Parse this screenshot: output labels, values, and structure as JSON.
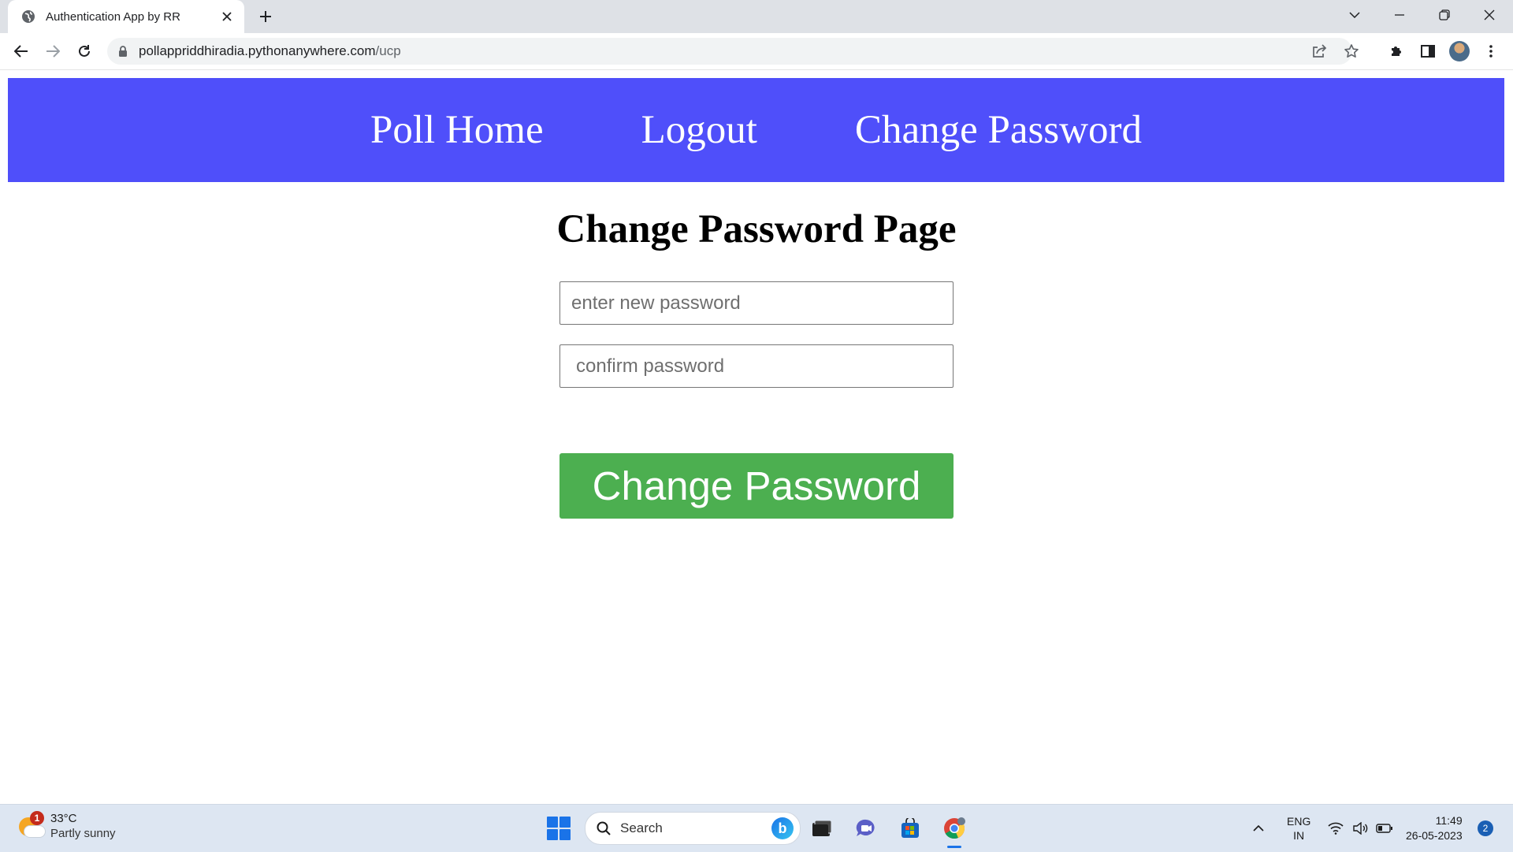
{
  "browser": {
    "tab_title": "Authentication App by RR",
    "url_host": "pollappriddhiradia.pythonanywhere.com",
    "url_path": "/ucp"
  },
  "nav": {
    "items": [
      {
        "label": "Poll Home"
      },
      {
        "label": "Logout"
      },
      {
        "label": "Change Password"
      }
    ],
    "background": "#4f4ffa"
  },
  "page": {
    "title": "Change Password Page",
    "new_password_placeholder": "enter new password",
    "confirm_password_placeholder": "confirm password",
    "submit_label": "Change Password",
    "submit_color": "#4caf50"
  },
  "taskbar": {
    "weather_badge": "1",
    "temperature": "33°C",
    "condition": "Partly sunny",
    "search_label": "Search",
    "lang_line1": "ENG",
    "lang_line2": "IN",
    "time": "11:49",
    "date": "26-05-2023",
    "notification_count": "2"
  }
}
